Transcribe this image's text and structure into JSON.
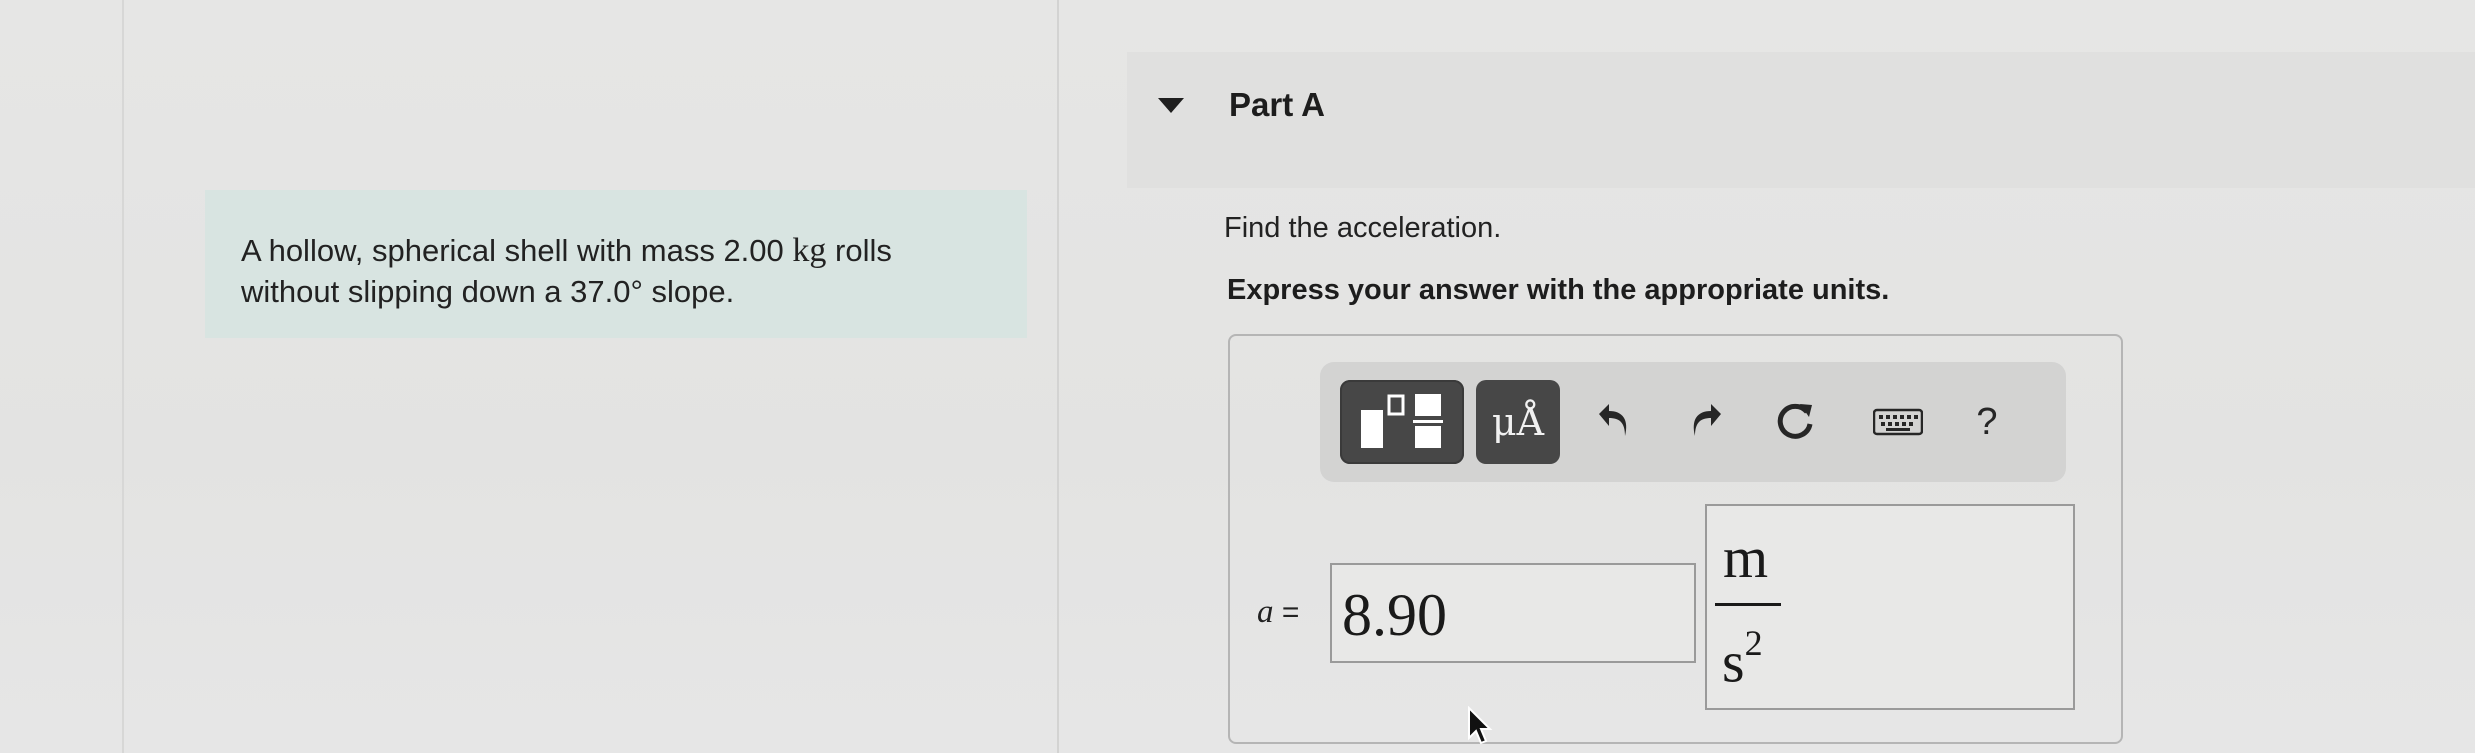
{
  "problem": {
    "text_before": "A hollow, spherical shell with mass 2.00 ",
    "unit_kg": "kg",
    "text_after": " rolls without slipping down a 37.0° slope."
  },
  "part": {
    "title": "Part A",
    "expanded": true
  },
  "question": {
    "prompt": "Find the acceleration.",
    "instruction": "Express your answer with the appropriate units."
  },
  "toolbar": {
    "templates_icon": "fraction-templates-icon",
    "units_label": "μÅ",
    "undo_icon": "undo-icon",
    "redo_icon": "redo-icon",
    "reset_icon": "reset-icon",
    "keyboard_icon": "keyboard-icon",
    "help_label": "?"
  },
  "answer": {
    "variable": "a",
    "equals": "=",
    "value": "8.90",
    "unit_numerator": "m",
    "unit_denominator": "s",
    "unit_exponent": "2"
  },
  "colors": {
    "problem_bg": "#d8e4e1",
    "toolbar_dark_button": "#474747",
    "toolbar_bg": "#d3d3d2"
  }
}
